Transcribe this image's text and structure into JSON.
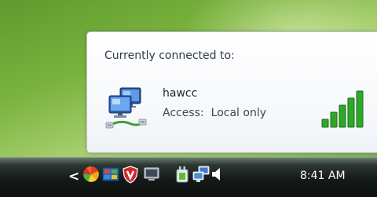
{
  "flyout": {
    "title": "Currently connected to:",
    "network": {
      "name": "hawcc",
      "access_label": "Access:",
      "access_value": "Local only",
      "signal_bars": 5
    }
  },
  "taskbar": {
    "clock": "8:41 AM",
    "tray_icons": [
      "show-hidden-icons-chevron",
      "pinwheel-app-icon",
      "windows-update-icon",
      "security-shield-icon",
      "display-icon",
      "power-plug-icon",
      "network-computers-icon",
      "volume-speaker-icon"
    ]
  },
  "colors": {
    "signal_green": "#2fa82a",
    "taskbar_dark": "#141a17",
    "flyout_bg": "#ffffff"
  }
}
